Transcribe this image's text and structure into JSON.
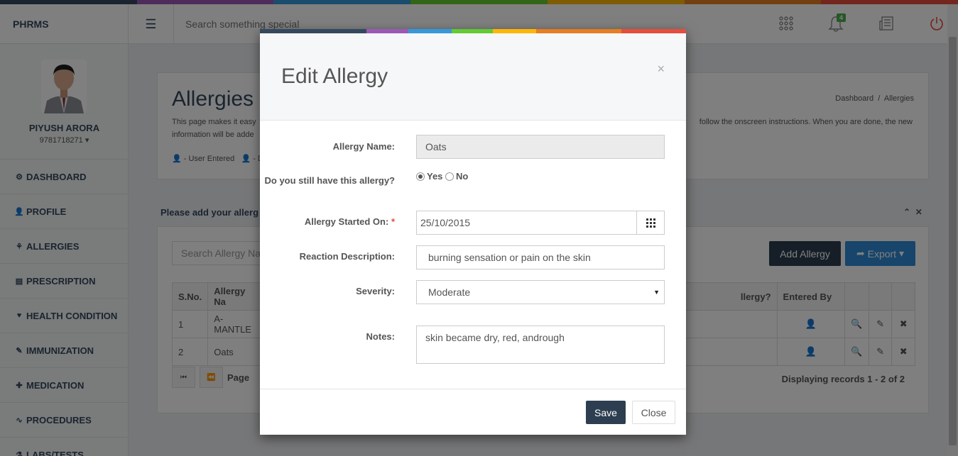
{
  "colors": {
    "stripe": [
      "#34495e",
      "#9b59b6",
      "#3498db",
      "#62cb31",
      "#ffb606",
      "#e67e22",
      "#e74c3c"
    ],
    "primary": "#2c3e50",
    "export": "#2f8bd6",
    "badge": "#4caf50"
  },
  "header": {
    "brand": "PHRMS",
    "search_placeholder": "Search something special",
    "notification_count": "4"
  },
  "user": {
    "name": "PIYUSH ARORA",
    "phone": "9781718271"
  },
  "sidebar": {
    "items": [
      {
        "label": "DASHBOARD",
        "icon": "dashboard-icon",
        "glyph": "⚙"
      },
      {
        "label": "PROFILE",
        "icon": "user-icon",
        "glyph": "👤"
      },
      {
        "label": "ALLERGIES",
        "icon": "allergy-icon",
        "glyph": "⚘"
      },
      {
        "label": "PRESCRIPTION",
        "icon": "prescription-icon",
        "glyph": "▤"
      },
      {
        "label": "HEALTH CONDITION",
        "icon": "stethoscope-icon",
        "glyph": "♥"
      },
      {
        "label": "IMMUNIZATION",
        "icon": "syringe-icon",
        "glyph": "✎"
      },
      {
        "label": "MEDICATION",
        "icon": "medkit-icon",
        "glyph": "✚"
      },
      {
        "label": "PROCEDURES",
        "icon": "procedure-icon",
        "glyph": "∿"
      },
      {
        "label": "LABS/TESTS",
        "icon": "flask-icon",
        "glyph": "⚗"
      }
    ]
  },
  "page": {
    "title": "Allergies",
    "description": "This page makes it easy",
    "description_tail": "follow the onscreen instructions. When you are done, the new",
    "description_line2": "information will be adde",
    "legend_user": "- User Entered",
    "legend_doctor": "- D",
    "breadcrumb_home": "Dashboard",
    "breadcrumb_sep": "/",
    "breadcrumb_current": "Allergies",
    "add_info": "Please add your allerg",
    "search_placeholder": "Search Allergy Na",
    "add_button": "Add Allergy",
    "export_button": "Export",
    "table": {
      "headers": [
        "S.No.",
        "Allergy Na",
        "llergy?",
        "Entered By"
      ],
      "rows": [
        {
          "sno": "1",
          "name": "A-MANTLE"
        },
        {
          "sno": "2",
          "name": "Oats"
        }
      ]
    },
    "pager_label": "Page",
    "records": "Displaying records 1 - 2 of 2"
  },
  "modal": {
    "title": "Edit Allergy",
    "close_symbol": "×",
    "fields": {
      "name_label": "Allergy Name:",
      "name_value": "Oats",
      "still_label": "Do you still have this allergy?",
      "yes_label": "Yes",
      "no_label": "No",
      "started_label": "Allergy Started On:",
      "required_mark": "*",
      "started_value": "25/10/2015",
      "reaction_label": "Reaction Description:",
      "reaction_value": "burning sensation or pain on the skin",
      "severity_label": "Severity:",
      "severity_value": "Moderate",
      "notes_label": "Notes:",
      "notes_value": "skin became dry, red, andrough"
    },
    "save_button": "Save",
    "close_button": "Close"
  }
}
